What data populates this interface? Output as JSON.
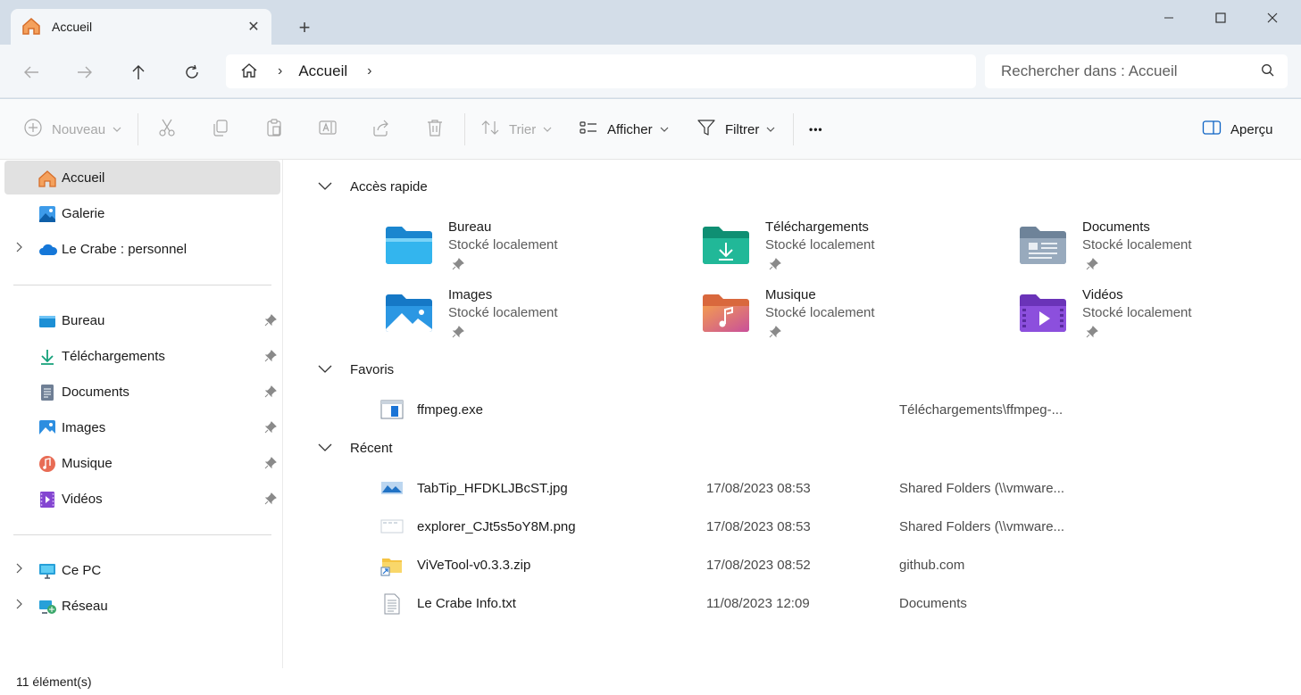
{
  "tab": {
    "title": "Accueil",
    "close": "✕",
    "new": "+"
  },
  "window": {
    "minimize": "—",
    "maximize": "☐",
    "close": "✕"
  },
  "address": {
    "crumb": "Accueil",
    "sep1": "›",
    "sep2": "›"
  },
  "search": {
    "placeholder": "Rechercher dans : Accueil"
  },
  "toolbar": {
    "new_label": "Nouveau",
    "sort_label": "Trier",
    "view_label": "Afficher",
    "filter_label": "Filtrer",
    "more": "•••",
    "preview_label": "Aperçu"
  },
  "sidebar": {
    "top": [
      {
        "label": "Accueil"
      },
      {
        "label": "Galerie"
      },
      {
        "label": "Le Crabe : personnel",
        "expander": "›"
      }
    ],
    "pinned": [
      {
        "label": "Bureau"
      },
      {
        "label": "Téléchargements"
      },
      {
        "label": "Documents"
      },
      {
        "label": "Images"
      },
      {
        "label": "Musique"
      },
      {
        "label": "Vidéos"
      }
    ],
    "bottom": [
      {
        "label": "Ce PC",
        "expander": "›"
      },
      {
        "label": "Réseau",
        "expander": "›"
      }
    ]
  },
  "sections": {
    "quick_access": "Accès rapide",
    "favorites": "Favoris",
    "recent": "Récent"
  },
  "quick_access": [
    {
      "name": "Bureau",
      "sub": "Stocké localement"
    },
    {
      "name": "Téléchargements",
      "sub": "Stocké localement"
    },
    {
      "name": "Documents",
      "sub": "Stocké localement"
    },
    {
      "name": "Images",
      "sub": "Stocké localement"
    },
    {
      "name": "Musique",
      "sub": "Stocké localement"
    },
    {
      "name": "Vidéos",
      "sub": "Stocké localement"
    }
  ],
  "favorites": [
    {
      "name": "ffmpeg.exe",
      "date": "",
      "location": "Téléchargements\\ffmpeg-..."
    }
  ],
  "recent": [
    {
      "name": "TabTip_HFDKLJBcST.jpg",
      "date": "17/08/2023 08:53",
      "location": "Shared Folders (\\\\vmware..."
    },
    {
      "name": "explorer_CJt5s5oY8M.png",
      "date": "17/08/2023 08:53",
      "location": "Shared Folders (\\\\vmware..."
    },
    {
      "name": "ViVeTool-v0.3.3.zip",
      "date": "17/08/2023 08:52",
      "location": "github.com"
    },
    {
      "name": "Le Crabe Info.txt",
      "date": "11/08/2023 12:09",
      "location": "Documents"
    }
  ],
  "status": {
    "count": "11 élément(s)"
  },
  "colors": {
    "titlebar": "#d3dde8",
    "tab": "#f3f6f9",
    "selected": "#e1e1e1",
    "folder_blue": "#1e8fd6",
    "folder_green": "#1aa78a",
    "folder_gray": "#8aa0b6",
    "folder_orange": "#ee7d55",
    "folder_purple": "#8a49d6"
  }
}
